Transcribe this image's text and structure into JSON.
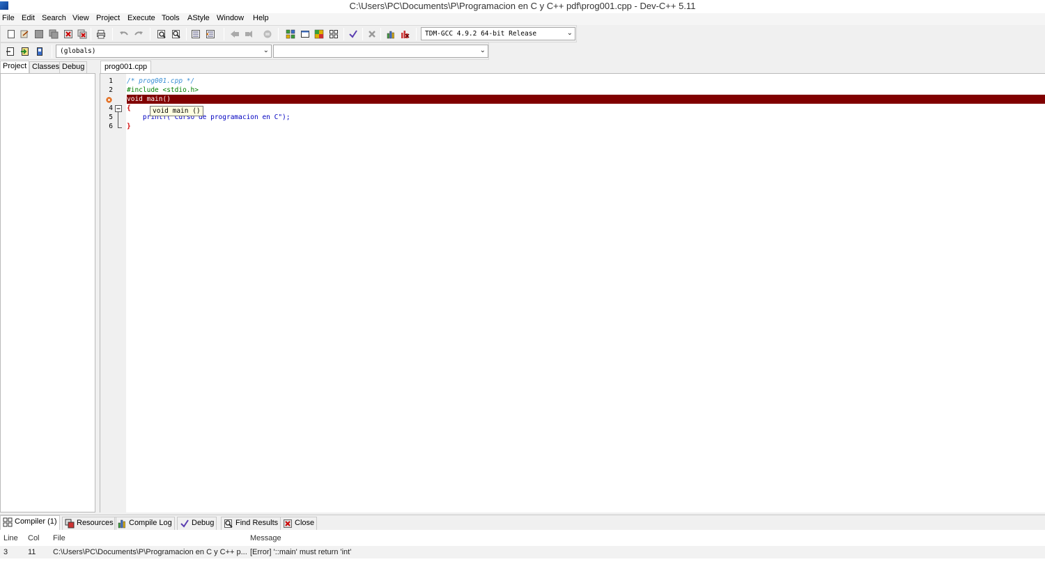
{
  "window": {
    "title": "C:\\Users\\PC\\Documents\\P\\Programacion en C y C++ pdf\\prog001.cpp - Dev-C++ 5.11"
  },
  "menu": [
    "File",
    "Edit",
    "Search",
    "View",
    "Project",
    "Execute",
    "Tools",
    "AStyle",
    "Window",
    "Help"
  ],
  "toolbar": {
    "compiler_select": "TDM-GCC 4.9.2 64-bit Release",
    "scope_select": "(globals)",
    "member_select": ""
  },
  "left_tabs": [
    "Project",
    "Classes",
    "Debug"
  ],
  "editor": {
    "file_tab": "prog001.cpp",
    "line_numbers": [
      "1",
      "2",
      "",
      "4",
      "5",
      "6"
    ],
    "lines": [
      "/* prog001.cpp */",
      "#include <stdio.h>",
      "void main()",
      "{",
      "    printf(\"Curso de programacion en C\");",
      "}"
    ],
    "tooltip": "void main ()",
    "error_line": 3
  },
  "bottom_tabs": [
    "Compiler (1)",
    "Resources",
    "Compile Log",
    "Debug",
    "Find Results",
    "Close"
  ],
  "messages": {
    "headers": {
      "line": "Line",
      "col": "Col",
      "file": "File",
      "message": "Message"
    },
    "rows": [
      {
        "line": "3",
        "col": "11",
        "file": "C:\\Users\\PC\\Documents\\P\\Programacion en C y C++ p...",
        "message": "[Error] '::main' must return 'int'"
      }
    ]
  },
  "colors": {
    "error_line_bg": "#800000",
    "comment": "#3a8fd4",
    "preprocessor": "#008000",
    "string": "#0000c0",
    "brace": "#d00000"
  }
}
